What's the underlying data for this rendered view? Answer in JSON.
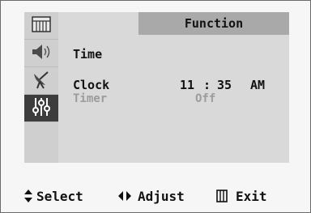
{
  "menu": {
    "title": "Function",
    "sidebar": [
      {
        "icon": "picture-icon"
      },
      {
        "icon": "speaker-icon"
      },
      {
        "icon": "antenna-icon"
      },
      {
        "icon": "function-sliders-icon",
        "active": true
      }
    ],
    "section_label": "Time",
    "clock": {
      "label": "Clock",
      "hour": "11",
      "separator": ":",
      "minute": "35",
      "ampm": "AM"
    },
    "timer": {
      "label": "Timer",
      "value": "Off"
    }
  },
  "footer": {
    "select_label": "Select",
    "adjust_label": "Adjust",
    "exit_label": "Exit"
  },
  "colors": {
    "panel": "#d9d9d9",
    "header": "#a9a9a9",
    "active_item": "#3d3d3d",
    "disabled_text": "#9c9c9c"
  }
}
